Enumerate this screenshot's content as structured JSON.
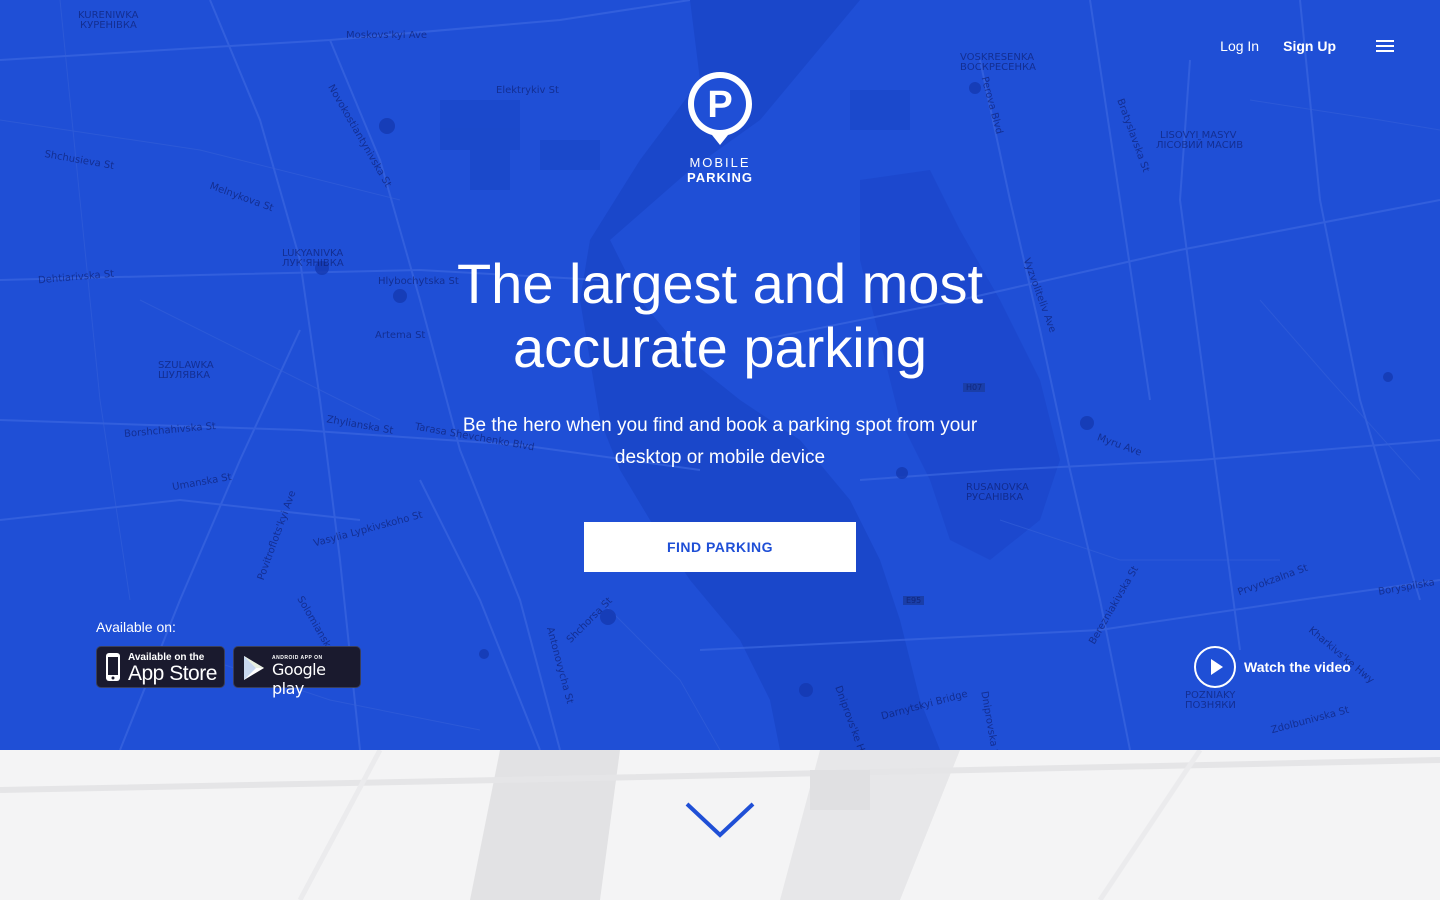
{
  "brand": {
    "line1": "MOBILE",
    "line2": "PARKING",
    "glyph": "P"
  },
  "nav": {
    "login_label": "Log In",
    "signup_label": "Sign Up",
    "menu_icon": "hamburger-menu-icon"
  },
  "hero": {
    "headline_line1": "The largest and most",
    "headline_line2": "accurate parking",
    "subline_line1": "Be the hero when you find and book a parking spot from your",
    "subline_line2": "desktop or mobile device",
    "cta_label": "FIND PARKING",
    "available_label": "Available on:",
    "appstore": {
      "small": "Available on the",
      "big": "App Store"
    },
    "googleplay": {
      "small": "ANDROID APP ON",
      "big": "Google play"
    },
    "video_label": "Watch the video"
  },
  "map_labels": [
    "KURENIWKA",
    "КУРЕНІВКА",
    "Moskovs'kyi Ave",
    "Elektrykiv St",
    "Novokostiantynivska St",
    "Shchusieva St",
    "Melnykova St",
    "Dehtiarivska St",
    "LUKYANIVKA",
    "ЛУК'ЯНІВКА",
    "Hlybochytska St",
    "Artema St",
    "SZULAWKA",
    "ШУЛЯВКА",
    "Borshchahivska St",
    "Zhylianska St",
    "Tarasa Shevchenko Blvd",
    "Umanska St",
    "Vasylia Lypkivskoho St",
    "Povitroflots'kyi Ave",
    "Solomianska St",
    "Shchorsa St",
    "Antonovycha St",
    "VOSKRESENKA",
    "ВОСКРЕСЕНКА",
    "Perova Blvd",
    "LISOVYI MASYV",
    "ЛІСОВИЙ МАСИВ",
    "Bratyslavska St",
    "Vyzvoliteliv Ave",
    "Darnytskyi Bridge",
    "RUSANOVKA",
    "РУСАНІВКА",
    "Myru Ave",
    "Prvyokzalna St",
    "Berezniakivska St",
    "Dniprovska St",
    "POZNIAKY",
    "ПОЗНЯКИ",
    "Zdolbunivska St",
    "Boryspilska",
    "Kharkivs'ke Hwy",
    "Dniprovs'ke Hwy",
    "E95",
    "H07"
  ]
}
